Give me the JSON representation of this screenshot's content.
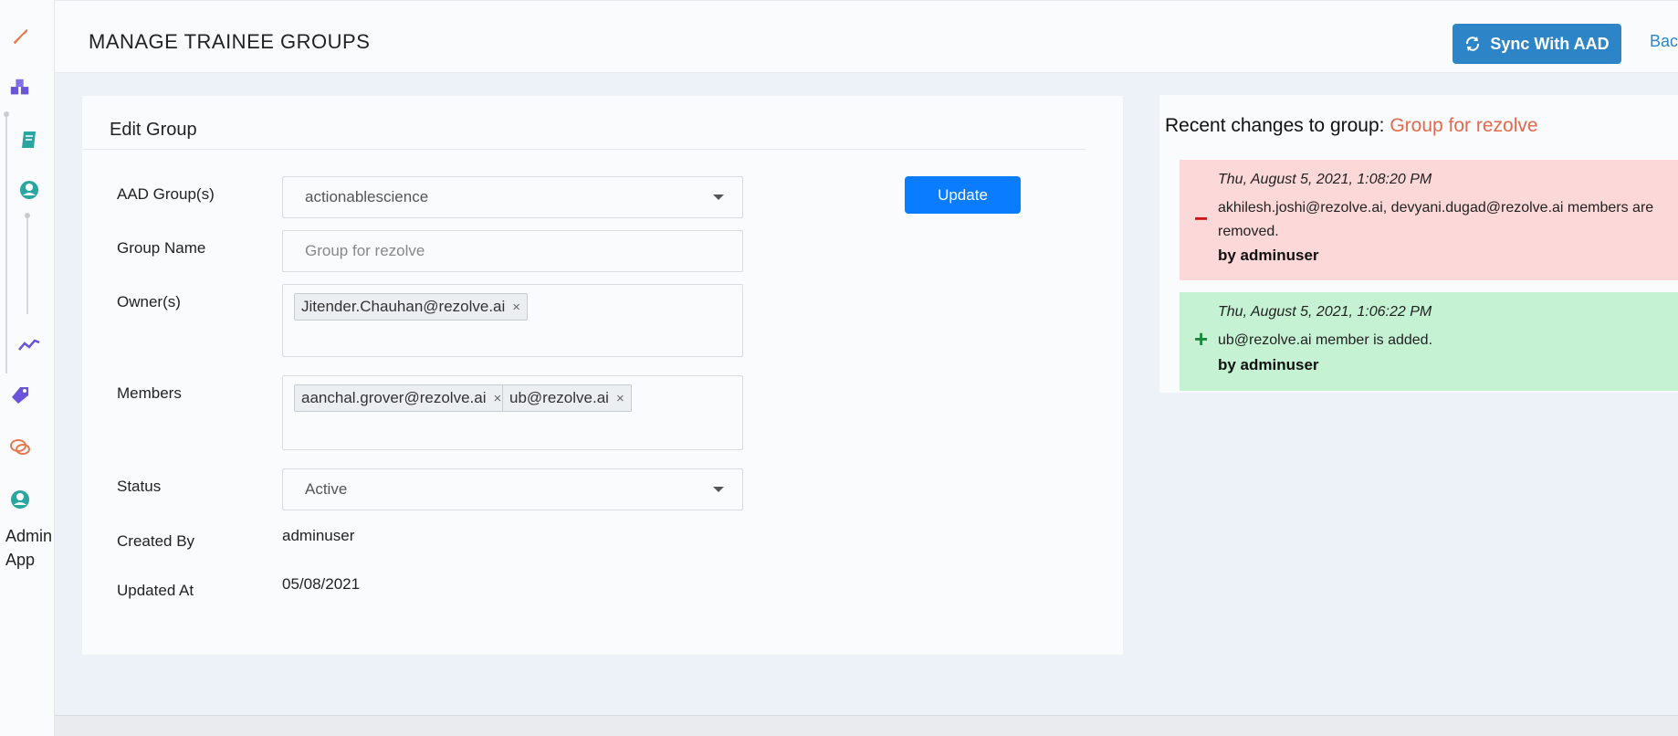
{
  "sidebar": {
    "icons": [
      "wrench-icon",
      "cubes-icon",
      "book-icon",
      "user-circle-icon",
      "trend-line-icon",
      "tag-icon",
      "chat-icon",
      "admin-user-icon"
    ],
    "label_line1": "Admin",
    "label_line2": "App",
    "colors": {
      "orange": "#e8794f",
      "purple": "#6a55d8",
      "teal": "#2aa6a0"
    }
  },
  "header": {
    "title": "MANAGE TRAINEE GROUPS",
    "sync_button": "Sync With AAD",
    "back_link": "Back"
  },
  "edit_group": {
    "title": "Edit Group",
    "update_button": "Update",
    "aad_groups": {
      "label": "AAD Group(s)",
      "value": "actionablescience"
    },
    "group_name": {
      "label": "Group Name",
      "placeholder": "Group for rezolve"
    },
    "owners": {
      "label": "Owner(s)",
      "tags": [
        "Jitender.Chauhan@rezolve.ai"
      ]
    },
    "members": {
      "label": "Members",
      "tags": [
        "aanchal.grover@rezolve.ai",
        "ub@rezolve.ai"
      ]
    },
    "status": {
      "label": "Status",
      "value": "Active"
    },
    "created_by": {
      "label": "Created By",
      "value": "adminuser"
    },
    "updated_at": {
      "label": "Updated At",
      "value": "05/08/2021"
    }
  },
  "recent_changes": {
    "title_prefix": "Recent changes to group:",
    "group_name": "Group for rezolve",
    "items": [
      {
        "type": "removed",
        "sign": "−",
        "time": "Thu, August 5, 2021, 1:08:20 PM",
        "message": "akhilesh.joshi@rezolve.ai, devyani.dugad@rezolve.ai members are removed.",
        "by": "by adminuser"
      },
      {
        "type": "added",
        "sign": "+",
        "time": "Thu, August 5, 2021, 1:06:22 PM",
        "message": "ub@rezolve.ai member is added.",
        "by": "by adminuser"
      }
    ]
  },
  "colors": {
    "primary": "#0a7cff",
    "sync_blue": "#2d85c8",
    "accent_orange": "#e4694c",
    "removed_bg": "#fcd8d8",
    "added_bg": "#c6f2d4"
  }
}
